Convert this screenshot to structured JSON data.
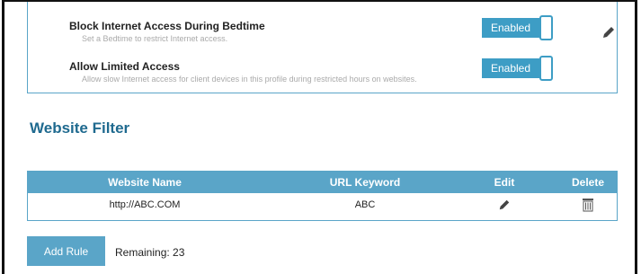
{
  "settings": [
    {
      "title": "Block Internet Access During Bedtime",
      "description": "Set a Bedtime to restrict Internet access.",
      "status": "Enabled"
    },
    {
      "title": "Allow Limited Access",
      "description": "Allow slow Internet access for client devices in this profile during restricted hours on websites.",
      "status": "Enabled"
    }
  ],
  "website_filter": {
    "title": "Website Filter",
    "columns": [
      "Website Name",
      "URL Keyword",
      "Edit",
      "Delete"
    ],
    "rows": [
      {
        "website_name": "http://ABC.COM",
        "url_keyword": "ABC",
        "edit_icon": "pencil-icon",
        "delete_icon": "trash-icon"
      }
    ]
  },
  "footer": {
    "add_rule_label": "Add Rule",
    "remaining_label": "Remaining:",
    "remaining_count": "23"
  },
  "colors": {
    "accent": "#3d9dc5",
    "header": "#5aa5c8",
    "title": "#1f6a8f"
  }
}
